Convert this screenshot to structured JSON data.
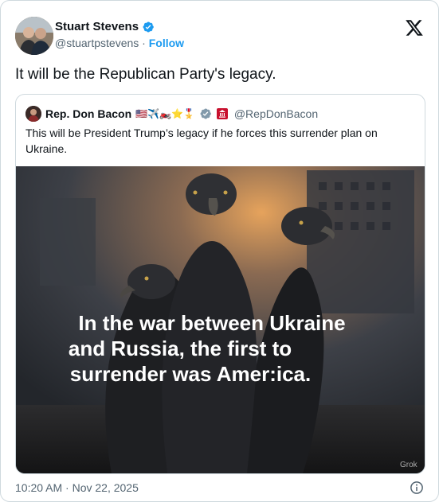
{
  "author": {
    "display_name": "Stuart Stevens",
    "handle": "@stuartpstevens",
    "separator": "·",
    "follow_label": "Follow"
  },
  "post": {
    "text": "It will be the Republican Party's legacy."
  },
  "quoted": {
    "display_name": "Rep. Don Bacon",
    "emojis": "🇺🇸✈️🏍️⭐🎖️",
    "handle": "@RepDonBacon",
    "text": "This will be President Trump’s legacy if he forces this surrender plan on Ukraine.",
    "image": {
      "caption_lines": [
        "In the war between Ukraine",
        "and Russia, the first to",
        "surrender was Amer:ica."
      ],
      "watermark": "Grok"
    }
  },
  "footer": {
    "timestamp": "10:20 AM · Nov 22, 2025"
  },
  "colors": {
    "accent": "#1d9bf0",
    "secondary_text": "#536471",
    "border": "#cfd9de"
  },
  "icons": {
    "verified": "verified-badge-icon",
    "x_logo": "x-logo-icon",
    "info": "info-icon"
  }
}
